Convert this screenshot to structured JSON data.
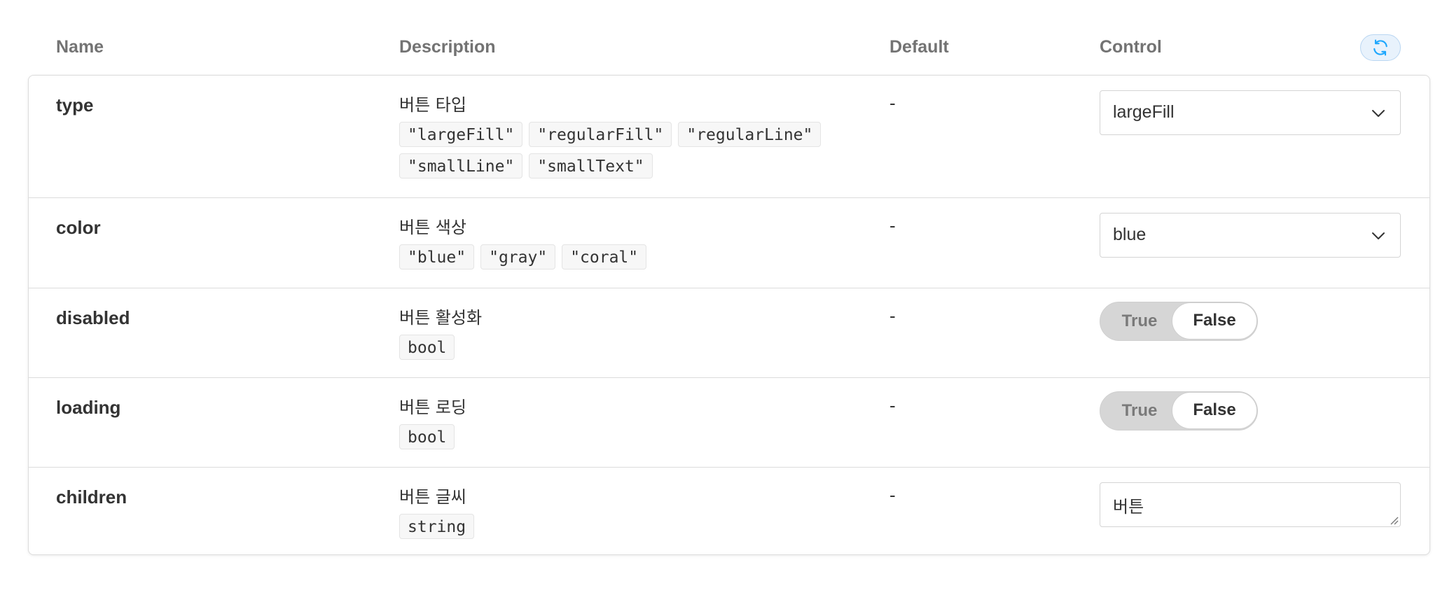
{
  "header": {
    "name": "Name",
    "description": "Description",
    "default": "Default",
    "control": "Control",
    "reset_icon": "refresh-icon",
    "accent": "#1ea7fd"
  },
  "rows": [
    {
      "name": "type",
      "description": "버튼 타입",
      "values": [
        "\"largeFill\"",
        "\"regularFill\"",
        "\"regularLine\"",
        "\"smallLine\"",
        "\"smallText\""
      ],
      "default": "-",
      "control": {
        "kind": "select",
        "value": "largeFill"
      }
    },
    {
      "name": "color",
      "description": "버튼 색상",
      "values": [
        "\"blue\"",
        "\"gray\"",
        "\"coral\""
      ],
      "default": "-",
      "control": {
        "kind": "select",
        "value": "blue"
      }
    },
    {
      "name": "disabled",
      "description": "버튼 활성화",
      "values": [
        "bool"
      ],
      "default": "-",
      "control": {
        "kind": "toggle",
        "true_label": "True",
        "false_label": "False",
        "selected": "False"
      }
    },
    {
      "name": "loading",
      "description": "버튼 로딩",
      "values": [
        "bool"
      ],
      "default": "-",
      "control": {
        "kind": "toggle",
        "true_label": "True",
        "false_label": "False",
        "selected": "False"
      }
    },
    {
      "name": "children",
      "description": "버튼 글씨",
      "values": [
        "string"
      ],
      "default": "-",
      "control": {
        "kind": "text",
        "value": "버튼"
      }
    }
  ]
}
